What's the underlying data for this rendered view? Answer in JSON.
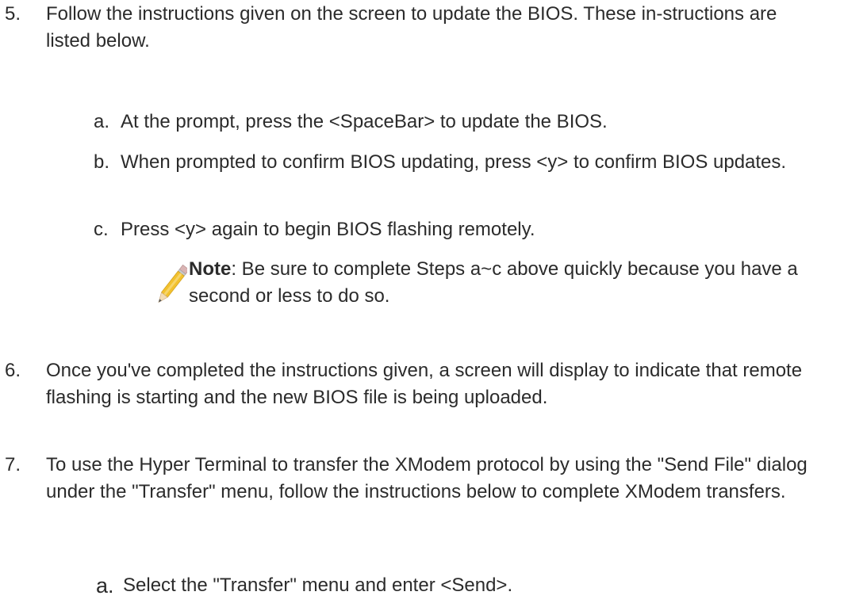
{
  "step5": {
    "number": "5.",
    "text": "Follow the instructions given on the screen to update the BIOS. These in-structions are listed below."
  },
  "substeps": [
    {
      "letter": "a.",
      "text": "At the prompt, press the <SpaceBar> to update the BIOS."
    },
    {
      "letter": "b.",
      "text": "When prompted to confirm BIOS updating, press <y> to confirm BIOS updates."
    },
    {
      "letter": "c.",
      "text": "Press <y> again to begin BIOS flashing remotely."
    }
  ],
  "note": {
    "label": "Note",
    "text": ": Be sure to complete Steps a~c above quickly because you have a second or less to do so.",
    "icon": "pencil-icon"
  },
  "step6": {
    "number": "6.",
    "text": "Once you've completed the instructions given, a screen will display to indicate that remote flashing is starting and the new BIOS file is being uploaded."
  },
  "step7": {
    "number": "7.",
    "text": "To use the Hyper Terminal to transfer the XModem protocol by using the \"Send File\" dialog under the \"Transfer\" menu, follow the instructions below to complete XModem transfers."
  },
  "step7_substeps": [
    {
      "letter": "a.",
      "text": "Select the \"Transfer\" menu and enter <Send>."
    }
  ]
}
